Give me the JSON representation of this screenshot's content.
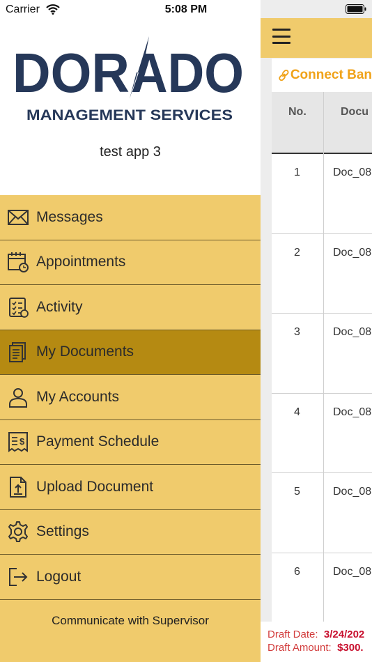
{
  "status_bar": {
    "carrier": "Carrier",
    "time": "5:08 PM"
  },
  "brand": {
    "name_part1": "DOR",
    "name_part2": "ADO",
    "tagline": "MANAGEMENT SERVICES",
    "color": "#263859"
  },
  "app_name": "test app 3",
  "menu": {
    "items": [
      {
        "label": "Messages",
        "icon": "envelope-icon"
      },
      {
        "label": "Appointments",
        "icon": "calendar-clock-icon"
      },
      {
        "label": "Activity",
        "icon": "checklist-icon"
      },
      {
        "label": "My Documents",
        "icon": "documents-icon",
        "active": true
      },
      {
        "label": "My Accounts",
        "icon": "user-icon"
      },
      {
        "label": "Payment Schedule",
        "icon": "bill-dollar-icon"
      },
      {
        "label": "Upload Document",
        "icon": "upload-document-icon"
      },
      {
        "label": "Settings",
        "icon": "gear-icon"
      },
      {
        "label": "Logout",
        "icon": "logout-icon"
      }
    ],
    "footer_link": "Communicate with Supervisor"
  },
  "main": {
    "connect_label": "Connect Ban",
    "table": {
      "headers": [
        "No.",
        "Docu"
      ],
      "rows": [
        {
          "no": "1",
          "doc": "Doc_08"
        },
        {
          "no": "2",
          "doc": "Doc_08"
        },
        {
          "no": "3",
          "doc": "Doc_08"
        },
        {
          "no": "4",
          "doc": "Doc_08"
        },
        {
          "no": "5",
          "doc": "Doc_08"
        },
        {
          "no": "6",
          "doc": "Doc_08"
        }
      ]
    },
    "draft": {
      "date_label": "Draft Date:",
      "date_value": "3/24/202",
      "amount_label": "Draft Amount:",
      "amount_value": "$300."
    }
  },
  "colors": {
    "menu_bg": "#f0cb6c",
    "menu_active": "#b58a12",
    "accent_orange": "#f0a31a",
    "draft_red": "#d23b3b"
  }
}
